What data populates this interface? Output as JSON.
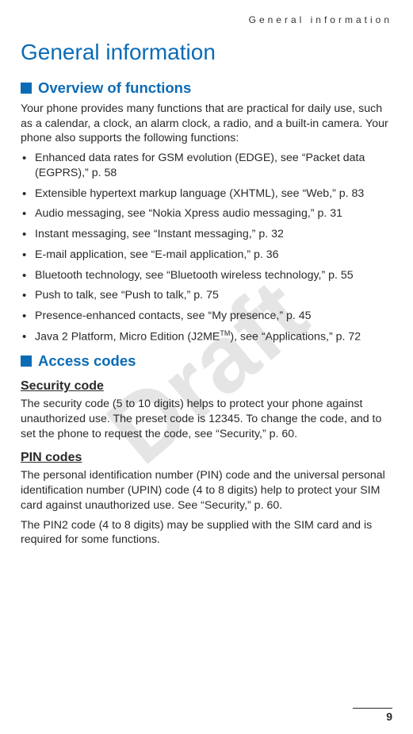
{
  "running_header": "General information",
  "chapter_title": "General information",
  "watermark": "Draft",
  "page_number": "9",
  "sections": {
    "overview": {
      "title": "Overview of functions",
      "intro": "Your phone provides many functions that are practical for daily use, such as a calendar, a clock, an alarm clock, a radio, and a built-in camera. Your phone also supports the following functions:",
      "items": [
        "Enhanced data rates for GSM evolution (EDGE), see “Packet data (EGPRS),” p. 58",
        "Extensible hypertext markup language (XHTML), see “Web,” p. 83",
        "Audio messaging, see “Nokia Xpress audio messaging,” p. 31",
        "Instant messaging, see “Instant messaging,” p. 32",
        "E-mail application, see “E-mail application,” p. 36",
        "Bluetooth technology, see “Bluetooth wireless technology,” p. 55",
        "Push to talk, see “Push to talk,” p. 75",
        "Presence-enhanced contacts, see “My presence,” p. 45",
        "Java 2 Platform, Micro Edition (J2METM), see “Applications,” p. 72"
      ]
    },
    "access_codes": {
      "title": "Access codes",
      "security": {
        "heading": "Security code",
        "text": "The security code (5 to 10 digits) helps to protect your phone against unauthorized use. The preset code is 12345. To change the code, and to set the phone to request the code, see “Security,” p. 60."
      },
      "pin": {
        "heading": "PIN codes",
        "text1": "The personal identification number (PIN) code and the universal personal identification number (UPIN) code (4 to 8 digits) help to protect your SIM card against unauthorized use. See “Security,” p. 60.",
        "text2": "The PIN2 code (4 to 8 digits) may be supplied with the SIM card and is required for some functions."
      }
    }
  }
}
